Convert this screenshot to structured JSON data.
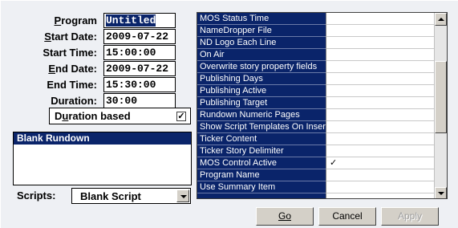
{
  "form": {
    "program": {
      "label": "Program",
      "value": "Untitled"
    },
    "start_date": {
      "label": "Start Date:",
      "value": "2009-07-22"
    },
    "start_time": {
      "label": "Start Time:",
      "value": "15:00:00"
    },
    "end_date": {
      "label": "End Date:",
      "value": "2009-07-22"
    },
    "end_time": {
      "label": "End Time:",
      "value": "15:30:00"
    },
    "duration": {
      "label": "Duration:",
      "value": "30:00"
    },
    "duration_based": {
      "label": "Duration based",
      "checked": true,
      "check_mark": "✓"
    }
  },
  "rundown_panel": {
    "title": "Blank Rundown"
  },
  "scripts": {
    "label": "Scripts:",
    "value": "Blank Script"
  },
  "properties": [
    {
      "name": "MOS Status Time",
      "value": ""
    },
    {
      "name": "NameDropper File",
      "value": ""
    },
    {
      "name": "ND Logo Each Line",
      "value": ""
    },
    {
      "name": "On Air",
      "value": ""
    },
    {
      "name": "Overwrite story property fields",
      "value": ""
    },
    {
      "name": "Publishing Days",
      "value": ""
    },
    {
      "name": "Publishing Active",
      "value": ""
    },
    {
      "name": "Publishing Target",
      "value": ""
    },
    {
      "name": "Rundown Numeric Pages",
      "value": ""
    },
    {
      "name": "Show Script Templates On Insert",
      "value": ""
    },
    {
      "name": "Ticker Content",
      "value": ""
    },
    {
      "name": "Ticker Story Delimiter",
      "value": ""
    },
    {
      "name": "MOS Control Active",
      "value": "✓"
    },
    {
      "name": "Program Name",
      "value": ""
    },
    {
      "name": "Use Summary Item",
      "value": ""
    },
    {
      "name": "",
      "value": ""
    }
  ],
  "buttons": {
    "go": "Go",
    "cancel": "Cancel",
    "apply": "Apply"
  }
}
